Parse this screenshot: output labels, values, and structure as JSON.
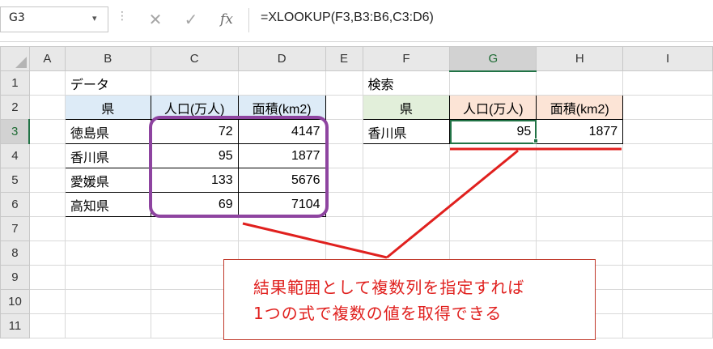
{
  "formula_bar": {
    "name_box": "G3",
    "formula": "=XLOOKUP(F3,B3:B6,C3:D6)",
    "fx_label": "fx",
    "cancel_glyph": "✕",
    "enter_glyph": "✓",
    "menu_dots": "⋮"
  },
  "columns": [
    "A",
    "B",
    "C",
    "D",
    "E",
    "F",
    "G",
    "H",
    "I"
  ],
  "rows": [
    "1",
    "2",
    "3",
    "4",
    "5",
    "6",
    "7",
    "8",
    "9",
    "10",
    "11"
  ],
  "cells": {
    "B1": "データ",
    "B2": "県",
    "C2": "人口(万人)",
    "D2": "面積(km2)",
    "B3": "徳島県",
    "C3": "72",
    "D3": "4147",
    "B4": "香川県",
    "C4": "95",
    "D4": "1877",
    "B5": "愛媛県",
    "C5": "133",
    "D5": "5676",
    "B6": "高知県",
    "C6": "69",
    "D6": "7104",
    "F1": "検索",
    "F2": "県",
    "G2": "人口(万人)",
    "H2": "面積(km2)",
    "F3": "香川県",
    "G3": "95",
    "H3": "1877"
  },
  "callout": {
    "line1": "結果範囲として複数列を指定すれば",
    "line2": "1つの式で複数の値を取得できる"
  },
  "colors": {
    "annotation_red": "#e0201e",
    "highlight_purple": "#8e44a0",
    "header_blue": "#ddebf7",
    "header_green": "#e2efda",
    "header_orange": "#fce4d6",
    "excel_green": "#217346"
  }
}
